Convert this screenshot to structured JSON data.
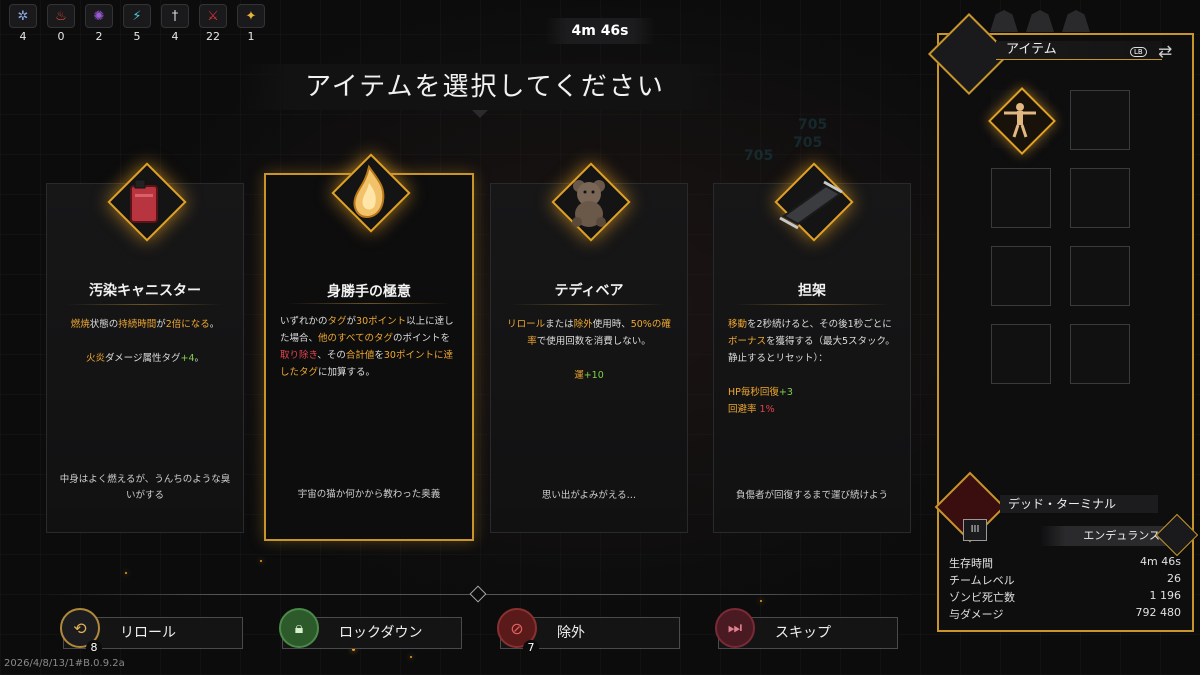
{
  "top_stats": [
    {
      "icon": "blue-skull-icon",
      "color": "#8fa9e0",
      "value": "4"
    },
    {
      "icon": "flame-icon",
      "color": "#e0503a",
      "value": "0"
    },
    {
      "icon": "purple-spark-icon",
      "color": "#9c5ad8",
      "value": "2"
    },
    {
      "icon": "cyan-claw-icon",
      "color": "#4fc7d6",
      "value": "5"
    },
    {
      "icon": "sword-icon",
      "color": "#d8d8d8",
      "value": "4"
    },
    {
      "icon": "red-claw-icon",
      "color": "#d8343a",
      "value": "22"
    },
    {
      "icon": "gold-star-icon",
      "color": "#e8b43a",
      "value": "1"
    }
  ],
  "timer": "4m 46s",
  "title": "アイテムを選択してください",
  "ghost_numbers": [
    "705",
    "705",
    "705"
  ],
  "cards": [
    {
      "name": "汚染キャニスター",
      "icon": "canister-icon",
      "desc_html": "<span class='or'>燃焼</span>状態の<span class='or'>持続時間</span>が<span class='or'>2倍になる</span>。<br><br><span class='or'>火炎</span>ダメージ属性タグ<span class='gr'>+4</span>。",
      "flavor": "中身はよく燃えるが、うんちのような臭いがする",
      "selected": false
    },
    {
      "name": "身勝手の極意",
      "icon": "flame-crystal-icon",
      "desc_html": "いずれかの<span class='or'>タグ</span>が<span class='or'>30ポイント</span>以上に達した場合、<span class='or'>他のすべてのタグ</span>のポイントを<span class='rd'>取り除き</span>、その<span class='or'>合計値</span>を<span class='or'>30ポイントに達したタグ</span>に加算する。",
      "flavor": "宇宙の猫か何かから教わった奥義",
      "selected": true
    },
    {
      "name": "テディベア",
      "icon": "teddy-bear-icon",
      "desc_html": "<span class='or'>リロール</span>または<span class='or'>除外</span>使用時、<span class='or'>50%の確率</span>で使用回数を消費しない。<br><br><span class='or'>運</span><span class='gr'>+10</span>",
      "flavor": "思い出がよみがえる…",
      "selected": false
    },
    {
      "name": "担架",
      "icon": "stretcher-icon",
      "desc_html": "<span class='or'>移動</span>を2秒続けると、その後1秒ごとに<span class='or'>ボーナス</span>を獲得する（最大5スタック。静止するとリセット）：<br><br><span class='or'>HP毎秒回復</span><span class='gr'>+3</span><br><span class='or'>回避率</span> <span class='rd'>1%</span>",
      "flavor": "負傷者が回復するまで運び続けよう",
      "selected": false
    }
  ],
  "buttons": [
    {
      "label": "リロール",
      "icon": "reroll-icon",
      "count": "8"
    },
    {
      "label": "ロックダウン",
      "icon": "lock-icon",
      "count": ""
    },
    {
      "label": "除外",
      "icon": "ban-icon",
      "count": "7"
    },
    {
      "label": "スキップ",
      "icon": "skip-icon",
      "count": ""
    }
  ],
  "version": "2026/4/8/13/1#B.0.9.2a",
  "panel": {
    "header": "アイテム",
    "lb": "LB",
    "character_name": "デッド・ターミナル",
    "rank": "III",
    "class": "エンデュランス",
    "stats": [
      {
        "label": "生存時間",
        "value": "4m 46s"
      },
      {
        "label": "チームレベル",
        "value": "26"
      },
      {
        "label": "ゾンビ死亡数",
        "value": "1 196"
      },
      {
        "label": "与ダメージ",
        "value": "792 480"
      }
    ]
  },
  "colors": {
    "gold": "#c8952a",
    "orange": "#f0a830",
    "green": "#7fd14a",
    "red": "#e0444a"
  }
}
